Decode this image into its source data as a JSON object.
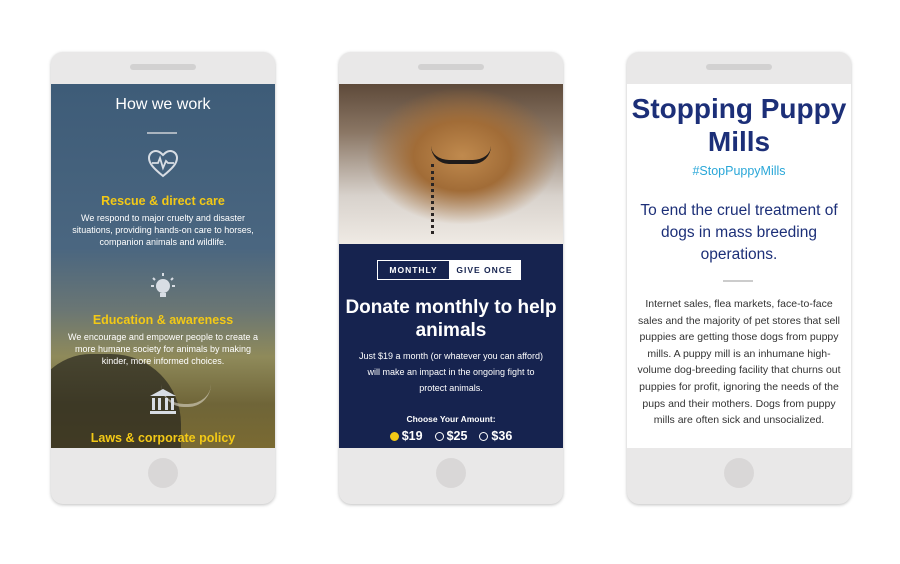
{
  "phone1": {
    "title": "How we work",
    "sections": [
      {
        "title": "Rescue & direct care",
        "body": "We respond to major cruelty and disaster situations, providing hands-on care to horses, companion animals and wildlife.",
        "icon": "heart-pulse-icon"
      },
      {
        "title": "Education & awareness",
        "body": "We encourage and empower people to create a more humane society for animals by making kinder, more informed choices.",
        "icon": "lightbulb-icon"
      },
      {
        "title": "Laws & corporate policy",
        "icon": "courthouse-icon"
      }
    ]
  },
  "phone2": {
    "toggle": {
      "monthly": "MONTHLY",
      "once": "GIVE ONCE"
    },
    "headline": "Donate monthly to help animals",
    "body": "Just $19 a month (or whatever you can afford) will make an impact in the ongoing fight to protect animals.",
    "choose_label": "Choose Your Amount:",
    "amounts": [
      "$19",
      "$25",
      "$36"
    ],
    "selected_amount": "$19",
    "colors": {
      "navy": "#16234f",
      "accent": "#f3c916"
    }
  },
  "phone3": {
    "title": "Stopping Puppy Mills",
    "hashtag": "#StopPuppyMills",
    "subtitle": "To end the cruel treatment of dogs in mass breeding operations.",
    "body": "Internet sales, flea markets, face-to-face sales and the majority of pet stores that sell puppies are getting those dogs from puppy mills. A puppy mill is an inhumane high-volume dog-breeding facility that churns out puppies for profit, ignoring the needs of the pups and their mothers. Dogs from puppy mills are often sick and unsocialized.",
    "colors": {
      "title": "#1c2f78",
      "hashtag": "#2aa7d8"
    }
  }
}
